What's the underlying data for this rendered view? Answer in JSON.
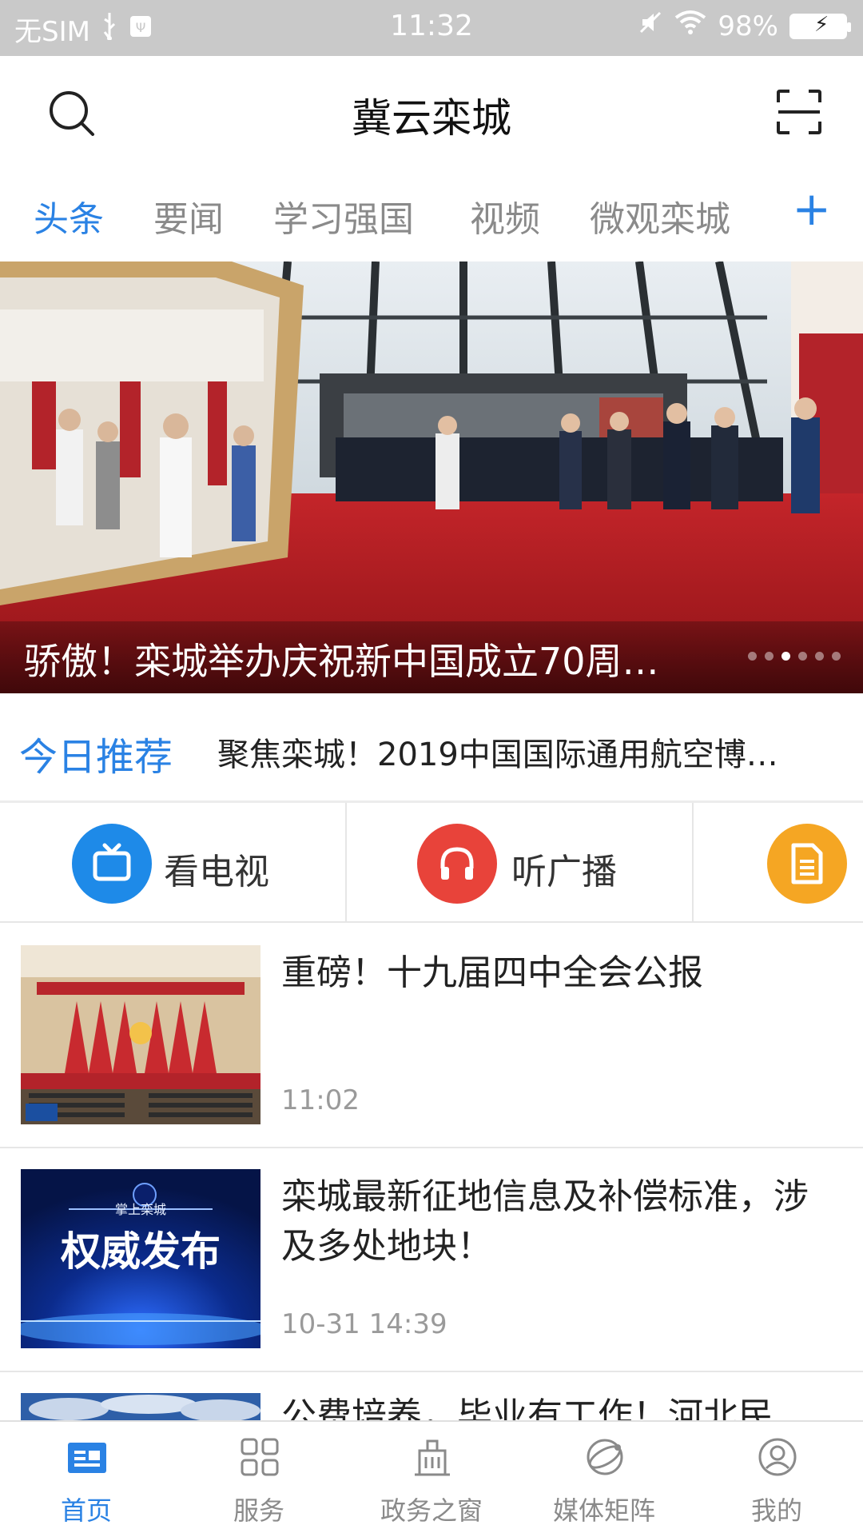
{
  "status_bar": {
    "carrier": "无SIM",
    "time": "11:32",
    "battery": "98%"
  },
  "header": {
    "title": "冀云栾城",
    "left_icon": "search-icon",
    "right_icon": "scan-icon"
  },
  "tabs": {
    "items": [
      "头条",
      "要闻",
      "学习强国",
      "视频",
      "微观栾城"
    ],
    "active_index": 0,
    "add_label": "+"
  },
  "banner": {
    "caption": "骄傲！栾城举办庆祝新中国成立70周…",
    "dot_count": 6,
    "active_dot": 2
  },
  "recommend": {
    "label": "今日推荐",
    "headline": "聚焦栾城！2019中国国际通用航空博…"
  },
  "quick_links": [
    {
      "label": "看电视",
      "icon": "tv-icon",
      "color": "#1e8ae8"
    },
    {
      "label": "听广播",
      "icon": "headphones-icon",
      "color": "#e8433a"
    },
    {
      "label": "",
      "icon": "document-icon",
      "color": "#f5a623"
    }
  ],
  "news": [
    {
      "title": "重磅！十九届四中全会公报",
      "time": "11:02",
      "thumb": "meeting-hall"
    },
    {
      "title": "栾城最新征地信息及补偿标准，涉及多处地块！",
      "time": "10-31 14:39",
      "thumb": "authority-release",
      "thumb_text": "权威发布",
      "thumb_subtext": "掌上栾城"
    },
    {
      "title": "公费培养，毕业有工作！河北民",
      "time": "",
      "thumb": "sky"
    }
  ],
  "bottom_nav": {
    "items": [
      {
        "label": "首页",
        "icon": "home-icon"
      },
      {
        "label": "服务",
        "icon": "grid-icon"
      },
      {
        "label": "政务之窗",
        "icon": "building-icon"
      },
      {
        "label": "媒体矩阵",
        "icon": "globe-icon"
      },
      {
        "label": "我的",
        "icon": "user-icon"
      }
    ],
    "active_index": 0
  },
  "colors": {
    "accent": "#2a82e4",
    "status_bar": "#c9c9c9"
  }
}
